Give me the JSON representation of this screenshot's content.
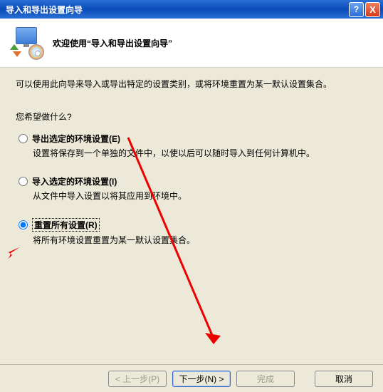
{
  "window": {
    "title": "导入和导出设置向导",
    "help": "?",
    "close": "X"
  },
  "header": {
    "heading": "欢迎使用“导入和导出设置向导”"
  },
  "body": {
    "intro": "可以使用此向导来导入或导出特定的设置类别，或将环境重置为某一默认设置集合。",
    "prompt": "您希望做什么?",
    "options": [
      {
        "label": "导出选定的环境设置(E)",
        "desc": "设置将保存到一个单独的文件中，以使以后可以随时导入到任何计算机中。"
      },
      {
        "label": "导入选定的环境设置(I)",
        "desc": "从文件中导入设置以将其应用到环境中。"
      },
      {
        "label": "重置所有设置(R)",
        "desc": "将所有环境设置重置为某一默认设置集合。"
      }
    ]
  },
  "footer": {
    "back": "< 上一步(P)",
    "next": "下一步(N) >",
    "finish": "完成",
    "cancel": "取消"
  },
  "selected_option": 2
}
